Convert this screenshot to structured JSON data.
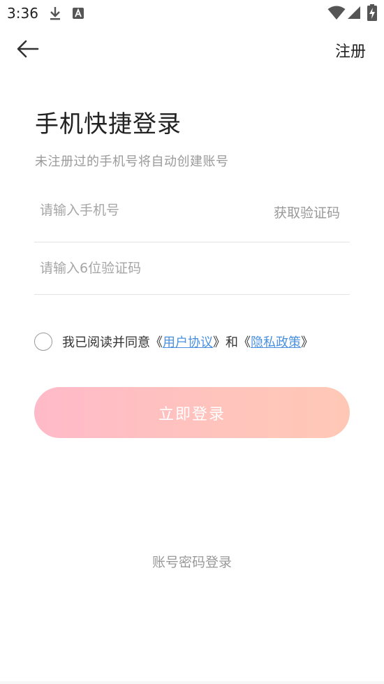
{
  "status_bar": {
    "time": "3:36",
    "icons": [
      "download-icon",
      "a11y-icon",
      "wifi-icon",
      "signal-icon",
      "battery-charging-icon"
    ]
  },
  "toolbar": {
    "back_icon": "arrow-left-icon",
    "register_label": "注册"
  },
  "header": {
    "title": "手机快捷登录",
    "subtitle": "未注册过的手机号将自动创建账号"
  },
  "form": {
    "phone_placeholder": "请输入手机号",
    "phone_value": "",
    "get_code_label": "获取验证码",
    "code_placeholder": "请输入6位验证码",
    "code_value": ""
  },
  "agreement": {
    "checked": false,
    "prefix": "我已阅读并同意《",
    "user_agreement": "用户协议",
    "middle": "》和《",
    "privacy_policy": "隐私政策",
    "suffix": "》"
  },
  "login_button_label": "立即登录",
  "password_login_label": "账号密码登录",
  "colors": {
    "accent_link": "#4a90e2",
    "button_gradient_start": "#ffbac9",
    "button_gradient_end": "#ffc8b6"
  }
}
